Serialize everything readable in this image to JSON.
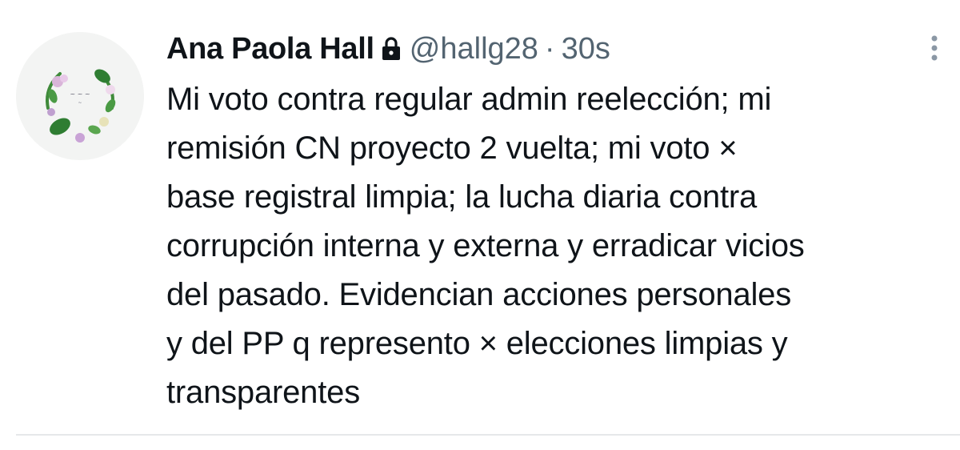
{
  "tweet": {
    "author_name": "Ana Paola Hall",
    "handle": "@hallg28",
    "separator": "·",
    "time": "30s",
    "text_lines": [
      "Mi voto contra regular admin reelección; mi",
      "remisión CN proyecto 2 vuelta; mi voto ×",
      "base registral limpia; la lucha diaria contra",
      "corrupción interna y externa y erradicar vicios",
      "del pasado. Evidencian acciones personales",
      "y del PP q represento × elecciones limpias y",
      "transparentes"
    ],
    "protected_icon": "lock-icon",
    "more_icon": "more-vertical-icon",
    "avatar_icon": "floral-wreath-avatar"
  },
  "colors": {
    "text": "#0f1419",
    "secondary": "#536471",
    "divider": "#e6e8ea",
    "background": "#ffffff"
  }
}
